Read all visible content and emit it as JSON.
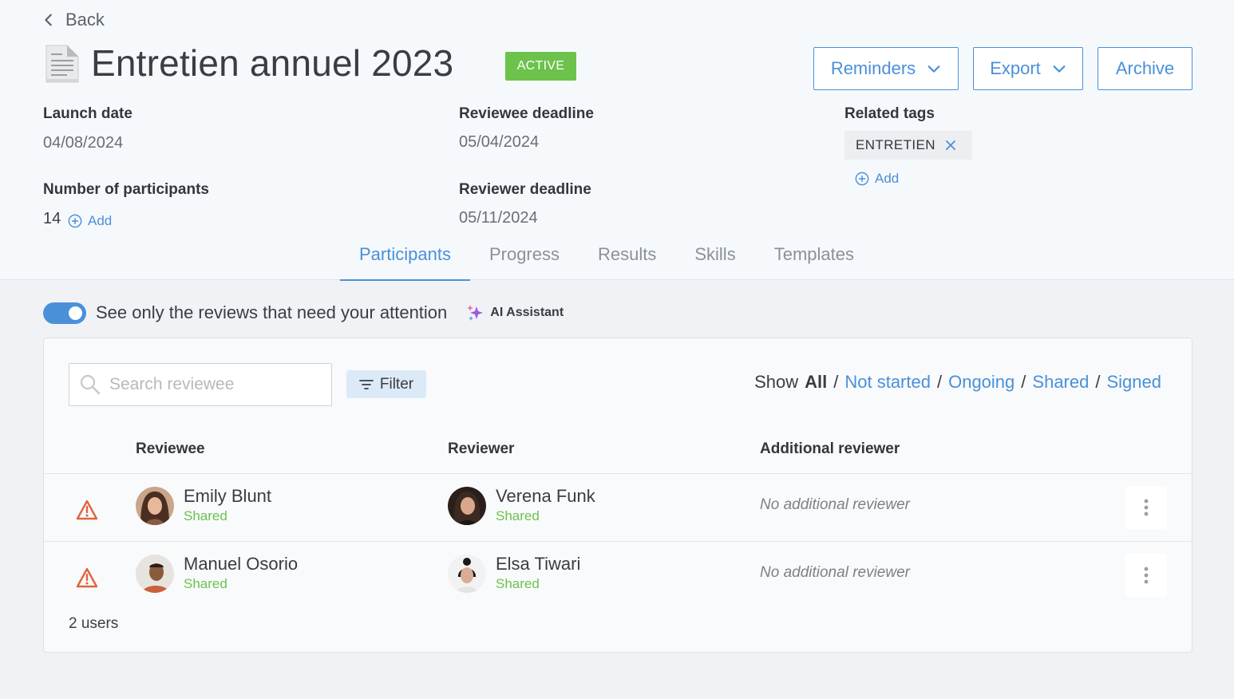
{
  "nav": {
    "back_label": "Back"
  },
  "campaign": {
    "title": "Entretien annuel 2023",
    "status": "ACTIVE",
    "status_color": "#6cc24a"
  },
  "actions": {
    "reminders_label": "Reminders",
    "export_label": "Export",
    "archive_label": "Archive"
  },
  "details": {
    "launch_date_label": "Launch date",
    "launch_date_value": "04/08/2024",
    "reviewee_deadline_label": "Reviewee deadline",
    "reviewee_deadline_value": "05/04/2024",
    "participants_label": "Number of participants",
    "participants_value": "14",
    "participants_add_label": "Add",
    "reviewer_deadline_label": "Reviewer deadline",
    "reviewer_deadline_value": "05/11/2024",
    "tags_label": "Related tags",
    "tags": [
      "ENTRETIEN"
    ],
    "tags_add_label": "Add"
  },
  "tabs": [
    {
      "label": "Participants",
      "active": true
    },
    {
      "label": "Progress",
      "active": false
    },
    {
      "label": "Results",
      "active": false
    },
    {
      "label": "Skills",
      "active": false
    },
    {
      "label": "Templates",
      "active": false
    }
  ],
  "attention_toggle": {
    "label": "See only the reviews that need your attention",
    "on": true
  },
  "ai_assistant_label": "AI Assistant",
  "table": {
    "search_placeholder": "Search reviewee",
    "filter_label": "Filter",
    "show": {
      "prefix": "Show",
      "options": [
        "All",
        "Not started",
        "Ongoing",
        "Shared",
        "Signed"
      ],
      "selected": "All"
    },
    "columns": {
      "reviewee": "Reviewee",
      "reviewer": "Reviewer",
      "additional": "Additional reviewer"
    },
    "rows": [
      {
        "warning_icon": "warning-triangle-icon",
        "reviewee": {
          "name": "Emily Blunt",
          "status": "Shared"
        },
        "reviewer": {
          "name": "Verena Funk",
          "status": "Shared"
        },
        "additional": "No additional reviewer"
      },
      {
        "warning_icon": "warning-triangle-icon",
        "reviewee": {
          "name": "Manuel Osorio",
          "status": "Shared"
        },
        "reviewer": {
          "name": "Elsa Tiwari",
          "status": "Shared"
        },
        "additional": "No additional reviewer"
      }
    ],
    "user_count": "2 users"
  },
  "colors": {
    "accent": "#4a90d9",
    "success": "#6cc24a",
    "warning": "#e0643c"
  }
}
